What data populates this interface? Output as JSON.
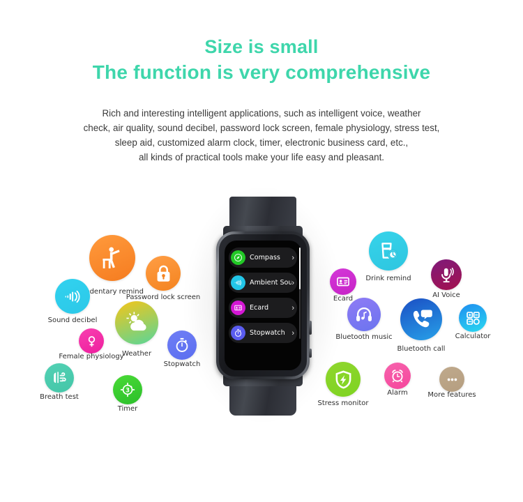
{
  "heading": {
    "line1": "Size is small",
    "line2": "The function is very comprehensive",
    "color": "#3ed6ab"
  },
  "description": {
    "line1": "Rich and interesting intelligent applications, such as intelligent voice, weather",
    "line2": "check, air quality, sound decibel, password lock screen, female physiology, stress test,",
    "line3": "sleep aid, customized alarm clock, timer, electronic business card, etc.,",
    "line4": "all kinds of practical tools make your life easy and pleasant."
  },
  "watch": {
    "menu": [
      {
        "label": "Compass",
        "icon": "compass-icon",
        "color": "#22c926",
        "chevron": "›"
      },
      {
        "label": "Ambient Sound",
        "icon": "sound-wave-icon",
        "color": "#22c6e8",
        "chevron": "›"
      },
      {
        "label": "Ecard",
        "icon": "id-card-icon",
        "color": "#d417d4",
        "chevron": "›"
      },
      {
        "label": "Stopwatch",
        "icon": "stopwatch-icon",
        "color": "#5a5cf0",
        "chevron": "›"
      }
    ]
  },
  "features": [
    {
      "label": "Sedentary remind",
      "icon": "stretching-person-icon",
      "color": "#f57c20",
      "color2": "#ff9a3c"
    },
    {
      "label": "Password lock screen",
      "icon": "padlock-icon",
      "color": "#f4831f",
      "color2": "#ff9e45"
    },
    {
      "label": "Sound decibel",
      "icon": "sound-wave-icon",
      "color": "#2cc8e8",
      "color2": "#31d2ef"
    },
    {
      "label": "Weather",
      "icon": "sun-cloud-icon",
      "color": "#57d69a",
      "color2": "#f5c518"
    },
    {
      "label": "Female physiology",
      "icon": "venus-symbol-icon",
      "color": "#ee1f9e",
      "color2": "#f83fb0"
    },
    {
      "label": "Stopwatch",
      "icon": "stopwatch-icon",
      "color": "#5b6ef0",
      "color2": "#6f7ef5"
    },
    {
      "label": "Breath test",
      "icon": "lungs-breath-icon",
      "color": "#44c6a8",
      "color2": "#52d1b4"
    },
    {
      "label": "Timer",
      "icon": "timer-dial-icon",
      "color": "#2bbf2b",
      "color2": "#4ada36"
    },
    {
      "label": "Drink remind",
      "icon": "water-glass-clock-icon",
      "color": "#2ec6e0",
      "color2": "#36d3ea"
    },
    {
      "label": "Ecard",
      "icon": "id-card-icon",
      "color": "#c622c6",
      "color2": "#d438d8"
    },
    {
      "label": "AI Voice",
      "icon": "microphone-icon",
      "color": "#a3114e",
      "color2": "#7f1a7a"
    },
    {
      "label": "Bluetooth music",
      "icon": "headphones-icon",
      "color": "#6b74ef",
      "color2": "#8f7bf5"
    },
    {
      "label": "Bluetooth call",
      "icon": "phone-bubble-icon",
      "color": "#27a0e8",
      "color2": "#1b4fc4"
    },
    {
      "label": "Calculator",
      "icon": "calculator-grid-icon",
      "color": "#2ad8f0",
      "color2": "#1f8ef0"
    },
    {
      "label": "Stress monitor",
      "icon": "shield-bolt-icon",
      "color": "#7ed321",
      "color2": "#8fd62e"
    },
    {
      "label": "Alarm",
      "icon": "alarm-clock-icon",
      "color": "#f5469c",
      "color2": "#f763ad"
    },
    {
      "label": "More features",
      "icon": "ellipsis-icon",
      "color": "#b59e80",
      "color2": "#bfa98c"
    }
  ]
}
